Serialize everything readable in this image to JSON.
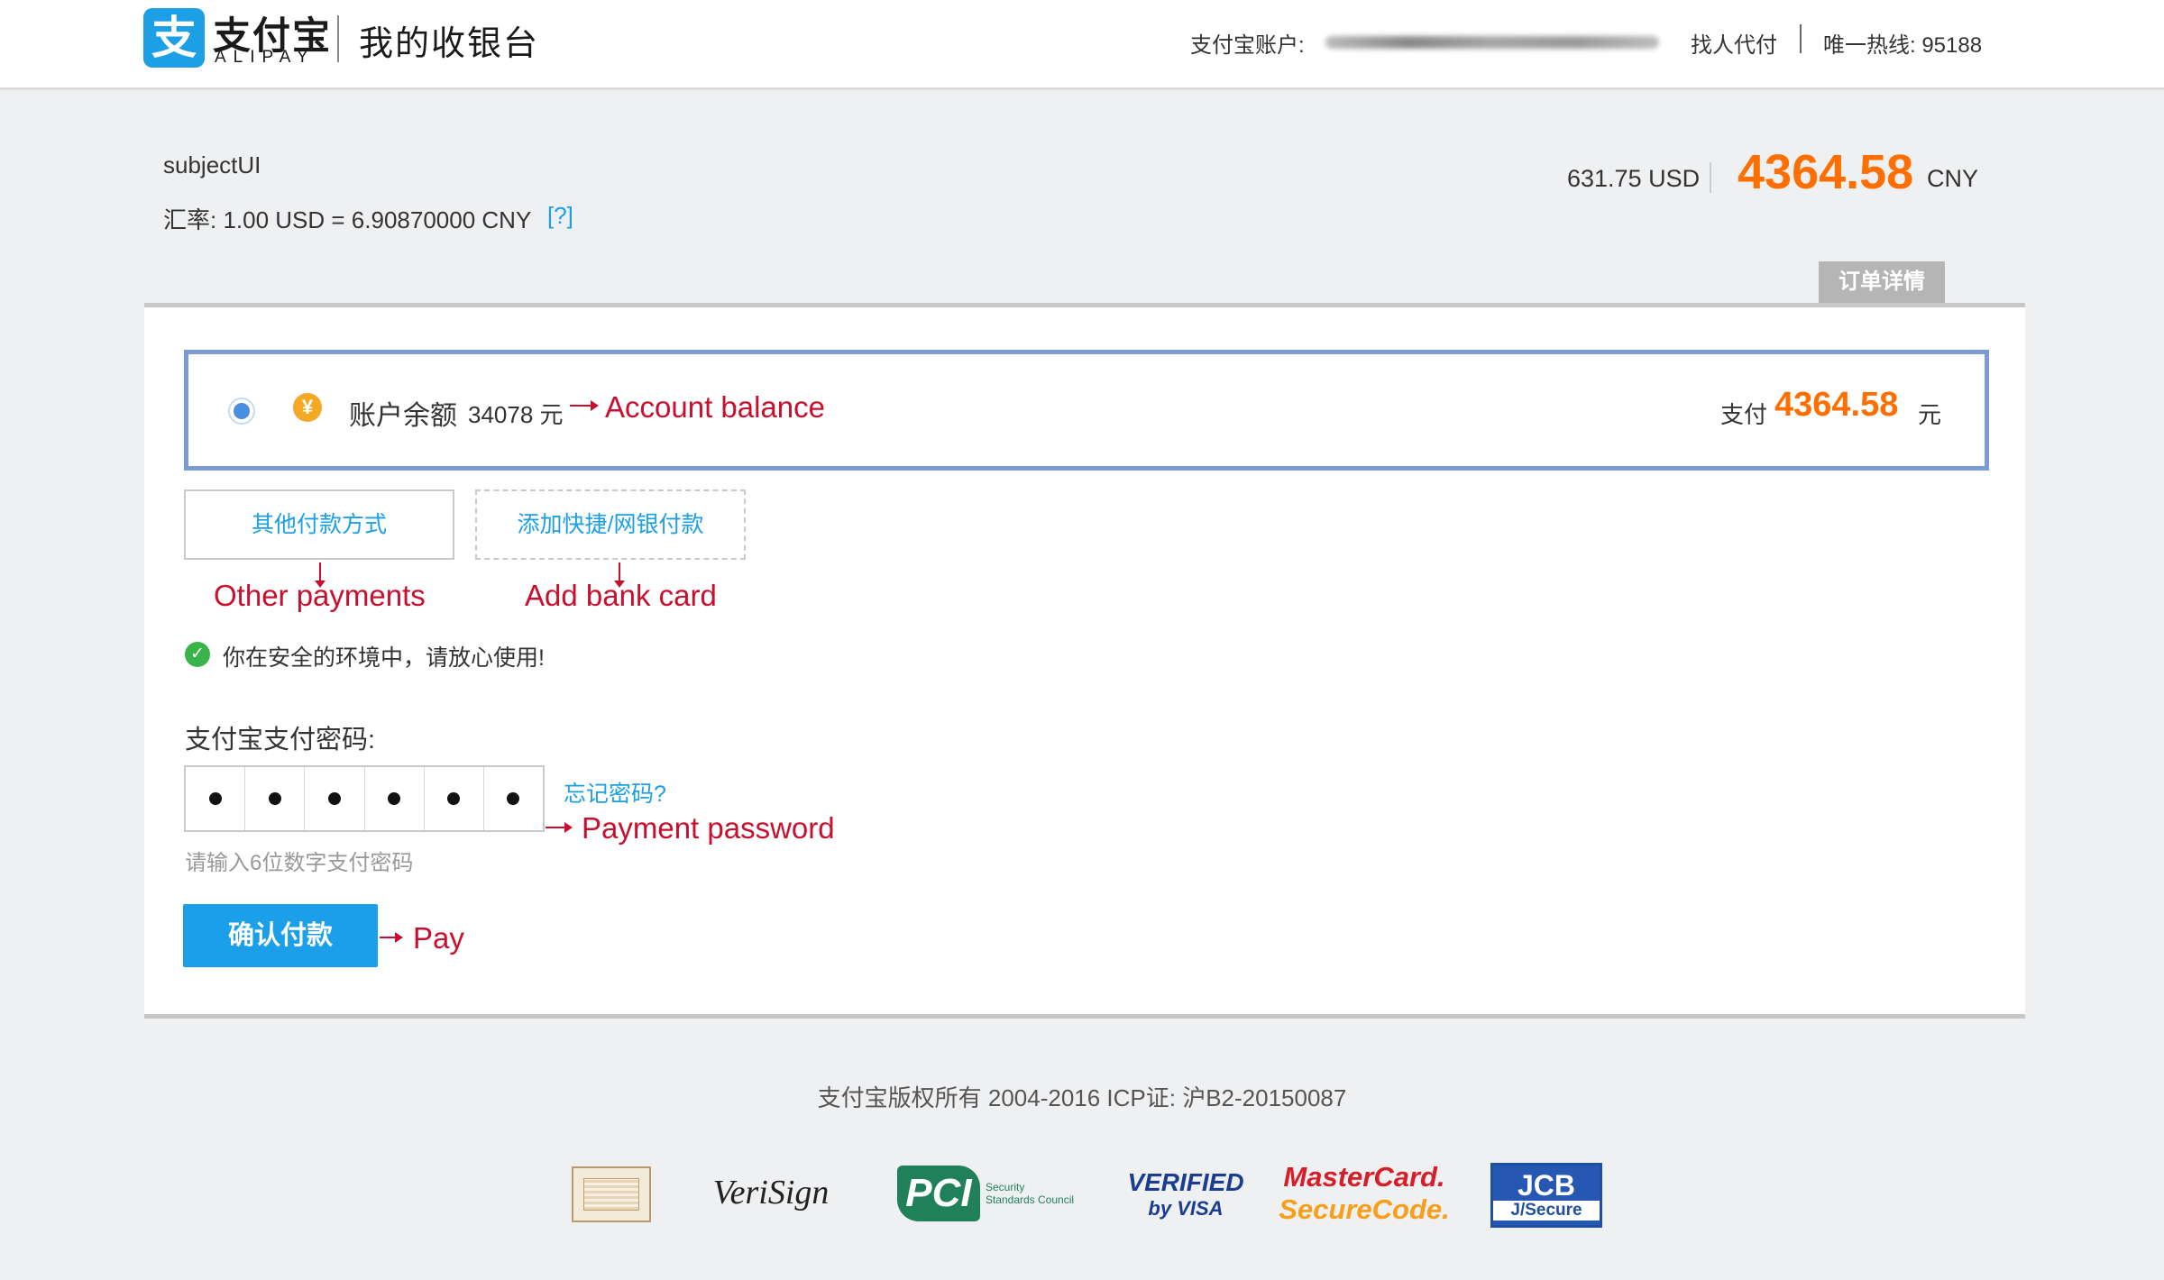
{
  "header": {
    "logo_mark": "支",
    "logo_zh": "支付宝",
    "logo_en": "ALIPAY",
    "title": "我的收银台",
    "account_label": "支付宝账户:",
    "proxy_pay": "找人代付",
    "hotline": "唯一热线: 95188"
  },
  "order": {
    "subject": "subjectUI",
    "rate_text": "汇率: 1.00 USD = 6.90870000 CNY",
    "rate_help": "[?]",
    "amount_usd": "631.75 USD",
    "amount_cny": "4364.58",
    "amount_unit": "CNY",
    "detail_tab": "订单详情"
  },
  "balance": {
    "icon": "¥",
    "label": "账户余额",
    "amount": "34078 元",
    "annotation": "Account balance",
    "pay_label": "支付",
    "pay_amount": "4364.58",
    "pay_unit": "元"
  },
  "methods": {
    "other_label": "其他付款方式",
    "other_annotation": "Other payments",
    "add_card_label": "添加快捷/网银付款",
    "add_card_annotation": "Add bank card"
  },
  "security": {
    "icon": "✓",
    "text": "你在安全的环境中，请放心使用!"
  },
  "password": {
    "label": "支付宝支付密码:",
    "forgot": "忘记密码?",
    "annotation": "Payment password",
    "hint": "请输入6位数字支付密码"
  },
  "confirm": {
    "label": "确认付款",
    "annotation": "Pay"
  },
  "footer": {
    "copyright": "支付宝版权所有 2004-2016 ICP证: 沪B2-20150087",
    "badges": {
      "verisign": "VeriSign",
      "pci": "PCI",
      "pci_sub1": "Security",
      "pci_sub2": "Standards Council",
      "visa_line1": "VERIFIED",
      "visa_line2": "by VISA",
      "mc_line1": "MasterCard.",
      "mc_line2": "SecureCode.",
      "jcb_line1": "JCB",
      "jcb_line2": "J/Secure"
    }
  },
  "colors": {
    "brand_blue": "#1c9fe5",
    "amount_orange": "#ff6e00",
    "annotation_red": "#c8102e",
    "selected_border": "#7b9bd1",
    "safe_green": "#38b449"
  }
}
